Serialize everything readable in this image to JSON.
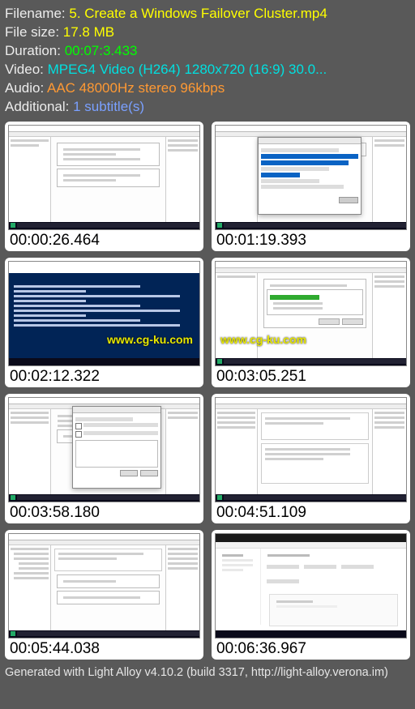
{
  "meta": {
    "filename_label": "Filename: ",
    "filename_value": "5. Create a Windows Failover Cluster.mp4",
    "filesize_label": "File size: ",
    "filesize_value": "17.8 MB",
    "duration_label": "Duration: ",
    "duration_value": "00:07:3.433",
    "video_label": "Video: ",
    "video_value": "MPEG4 Video (H264) 1280x720 (16:9) 30.0...",
    "audio_label": "Audio: ",
    "audio_value": "AAC 48000Hz stereo 96kbps",
    "additional_label": "Additional: ",
    "additional_value": "1 subtitle(s)"
  },
  "thumbs": {
    "t1": "00:00:26.464",
    "t2": "00:01:19.393",
    "t3": "00:02:12.322",
    "t4": "00:03:05.251",
    "t5": "00:03:58.180",
    "t6": "00:04:51.109",
    "t7": "00:05:44.038",
    "t8": "00:06:36.967"
  },
  "watermark": "www.cg-ku.com",
  "footer": "Generated with Light Alloy v4.10.2 (build 3317, http://light-alloy.verona.im)"
}
